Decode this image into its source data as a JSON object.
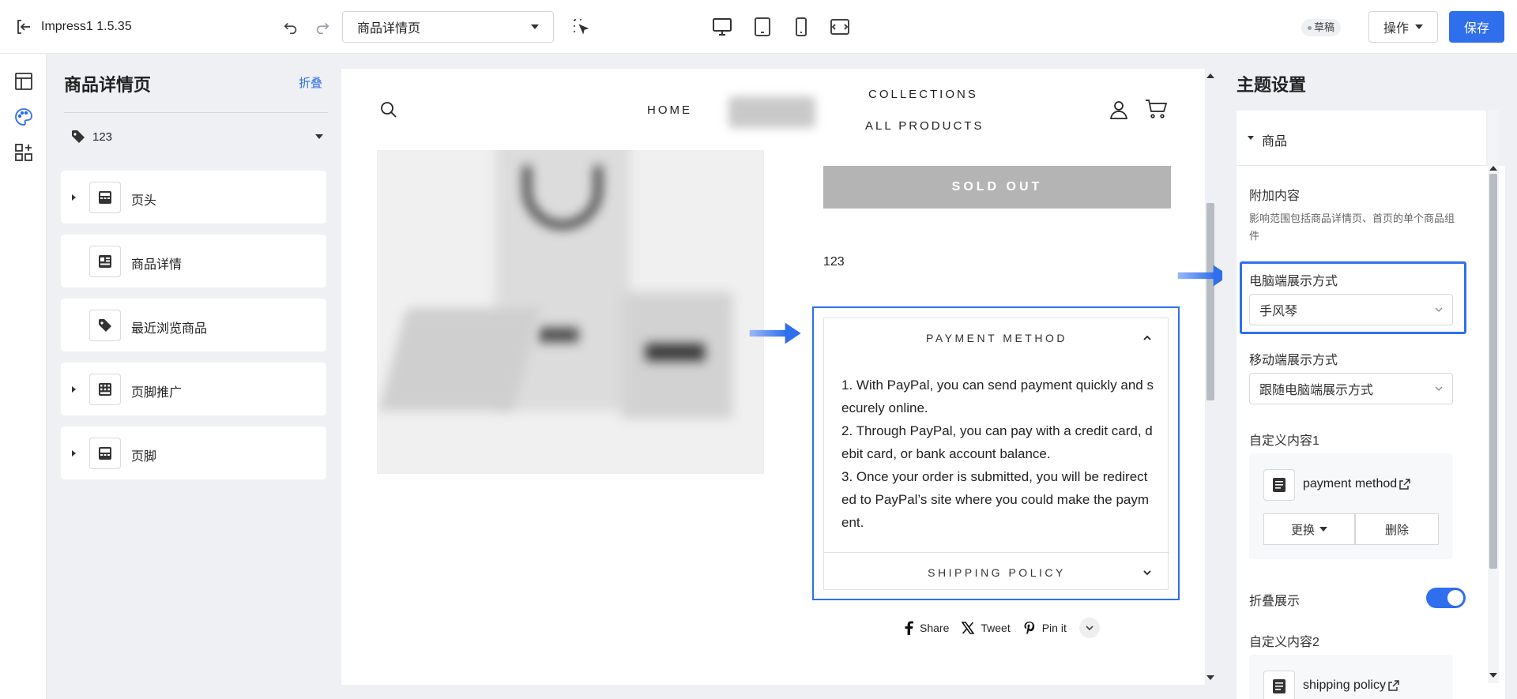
{
  "topbar": {
    "app_name": "Impress1 1.5.35",
    "page_select": "商品详情页",
    "status": "草稿",
    "ops_label": "操作",
    "save_label": "保存"
  },
  "left_panel": {
    "title": "商品详情页",
    "collapse_label": "折叠",
    "product": "123",
    "sections": [
      {
        "label": "页头",
        "expandable": true,
        "icon": "header-icon"
      },
      {
        "label": "商品详情",
        "expandable": false,
        "icon": "product-detail-icon"
      },
      {
        "label": "最近浏览商品",
        "expandable": false,
        "icon": "tag-icon"
      },
      {
        "label": "页脚推广",
        "expandable": true,
        "icon": "footer-promo-icon"
      },
      {
        "label": "页脚",
        "expandable": true,
        "icon": "footer-icon"
      }
    ]
  },
  "preview": {
    "nav": {
      "home": "HOME",
      "collections": "COLLECTIONS",
      "all_products": "ALL PRODUCTS"
    },
    "sold_out": "SOLD OUT",
    "product_value": "123",
    "accordion": {
      "payment_title": "PAYMENT METHOD",
      "payment_body_1": "1. With PayPal, you can send payment quickly and securely online.",
      "payment_body_2": "2. Through PayPal, you can pay with a credit card, debit card, or bank account balance.",
      "payment_body_3": "3. Once your order is submitted, you will be redirected to PayPal’s site where you could make the payment.",
      "shipping_title": "SHIPPING POLICY"
    },
    "share": {
      "share": "Share",
      "tweet": "Tweet",
      "pin": "Pin it"
    }
  },
  "right_panel": {
    "title": "主题设置",
    "group": "商品",
    "extra_content_label": "附加内容",
    "extra_content_desc": "影响范围包括商品详情页、首页的单个商品组件",
    "desktop_display_label": "电脑端展示方式",
    "desktop_display_value": "手风琴",
    "mobile_display_label": "移动端展示方式",
    "mobile_display_value": "跟随电脑端展示方式",
    "custom1_label": "自定义内容1",
    "custom1_name": "payment method",
    "replace_label": "更换",
    "delete_label": "删除",
    "collapse_display_label": "折叠展示",
    "collapse_display_on": true,
    "custom2_label": "自定义内容2",
    "custom2_name": "shipping policy"
  },
  "colors": {
    "accent": "#2f6fed",
    "sold_out_bg": "#b4b4b4"
  }
}
